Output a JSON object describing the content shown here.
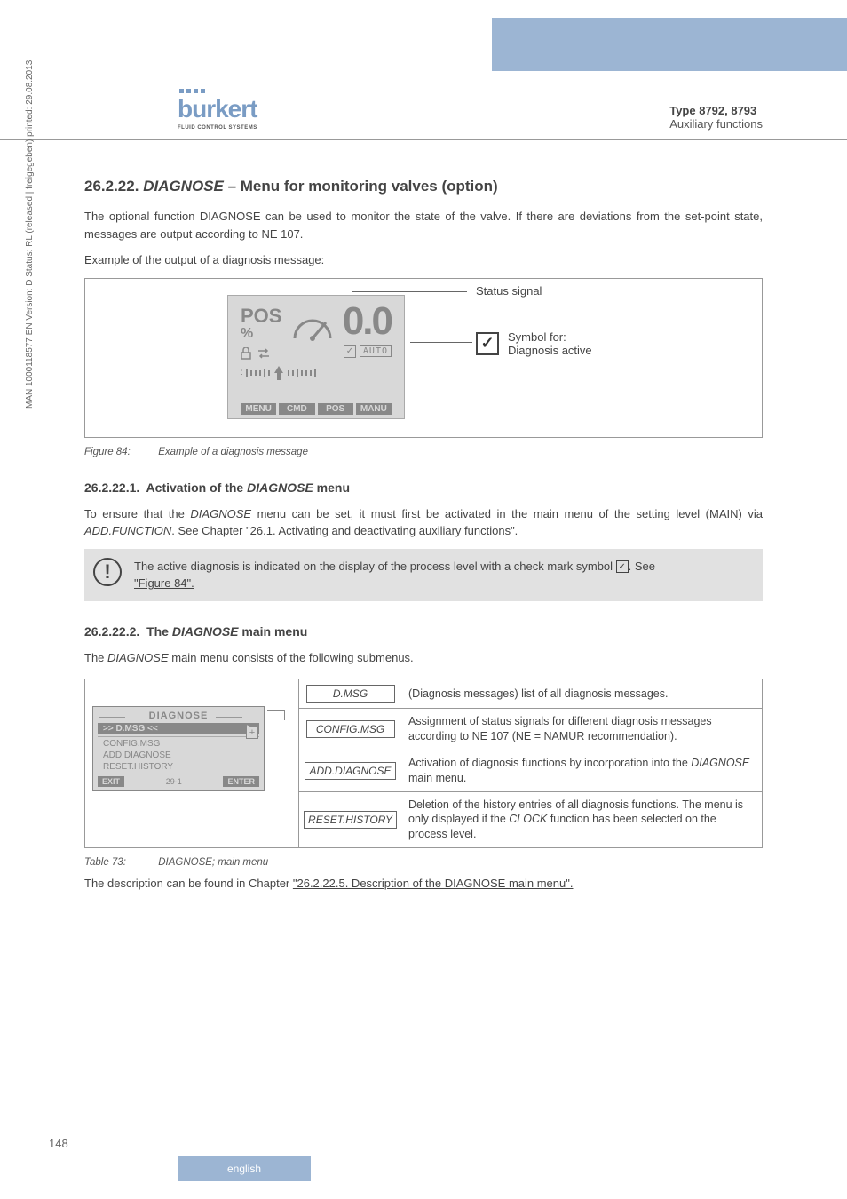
{
  "header": {
    "logo_name": "burkert",
    "logo_sub": "FLUID CONTROL SYSTEMS",
    "type_line": "Type 8792, 8793",
    "aux_line": "Auxiliary functions"
  },
  "section": {
    "num": "26.2.22.",
    "title_italic": "DIAGNOSE",
    "title_rest": " – Menu for monitoring valves (option)",
    "intro": "The optional function DIAGNOSE can be used to monitor the state of the valve. If there are deviations from the set-point state, messages are output according to NE 107.",
    "example_line": "Example of the output of a diagnosis message:"
  },
  "lcd": {
    "pos_label": "POS",
    "pct": "%",
    "big_value": "0.0",
    "auto": "AUTO",
    "buttons": [
      "MENU",
      "CMD",
      "POS",
      "MANU"
    ],
    "callout_status": "Status signal",
    "callout_symbol1": "Symbol for:",
    "callout_symbol2": "Diagnosis active"
  },
  "fig84": {
    "label": "Figure 84:",
    "text": "Example of a diagnosis message"
  },
  "sub1": {
    "num": "26.2.22.1.",
    "title_pre": "Activation of the ",
    "title_italic": "DIAGNOSE",
    "title_post": " menu",
    "body_pre": "To ensure that the ",
    "body_i1": "DIAGNOSE",
    "body_mid": " menu can be set, it must first be activated in the main menu of the setting level (MAIN) via ",
    "body_i2": "ADD.FUNCTION",
    "body_end": ". See Chapter ",
    "body_link": "\"26.1. Activating and deactivating auxiliary functions\"."
  },
  "note": {
    "text_pre": "The active diagnosis is indicated on the display of the process level with a check mark symbol ",
    "text_post": ". See ",
    "link": "\"Figure 84\"."
  },
  "sub2": {
    "num": "26.2.22.2.",
    "title_pre": "The ",
    "title_italic": "DIAGNOSE",
    "title_post": " main menu",
    "intro_pre": "The ",
    "intro_italic": "DIAGNOSE",
    "intro_post": " main menu consists of the following submenus."
  },
  "device_menu": {
    "title": "DIAGNOSE",
    "selected": ">> D.MSG <<",
    "items": [
      "CONFIG.MSG",
      "ADD.DIAGNOSE",
      "RESET.HISTORY"
    ],
    "btn_left": "EXIT",
    "btn_mid": "29-1",
    "btn_right": "ENTER"
  },
  "table": {
    "rows": [
      {
        "key": "D.MSG",
        "desc": "(Diagnosis messages) list of all diagnosis messages."
      },
      {
        "key": "CONFIG.MSG",
        "desc": "Assignment of status signals for different diagnosis messages according to NE 107 (NE = NAMUR recommendation)."
      },
      {
        "key": "ADD.DIAGNOSE",
        "desc": "Activation of diagnosis functions by incorporation into the DIAGNOSE main menu."
      },
      {
        "key": "RESET.HISTORY",
        "desc": "Deletion of the history entries of all diagnosis functions. The menu is only displayed if the CLOCK function has been selected on the process level."
      }
    ]
  },
  "table73": {
    "label": "Table 73:",
    "text": "DIAGNOSE; main menu"
  },
  "bottom": {
    "pre": "The description can be found in Chapter ",
    "link": "\"26.2.22.5. Description of the DIAGNOSE main menu\"."
  },
  "side": "MAN 1000118577 EN Version: D Status: RL (released | freigegeben) printed: 29.08.2013",
  "page": "148",
  "footer": "english"
}
